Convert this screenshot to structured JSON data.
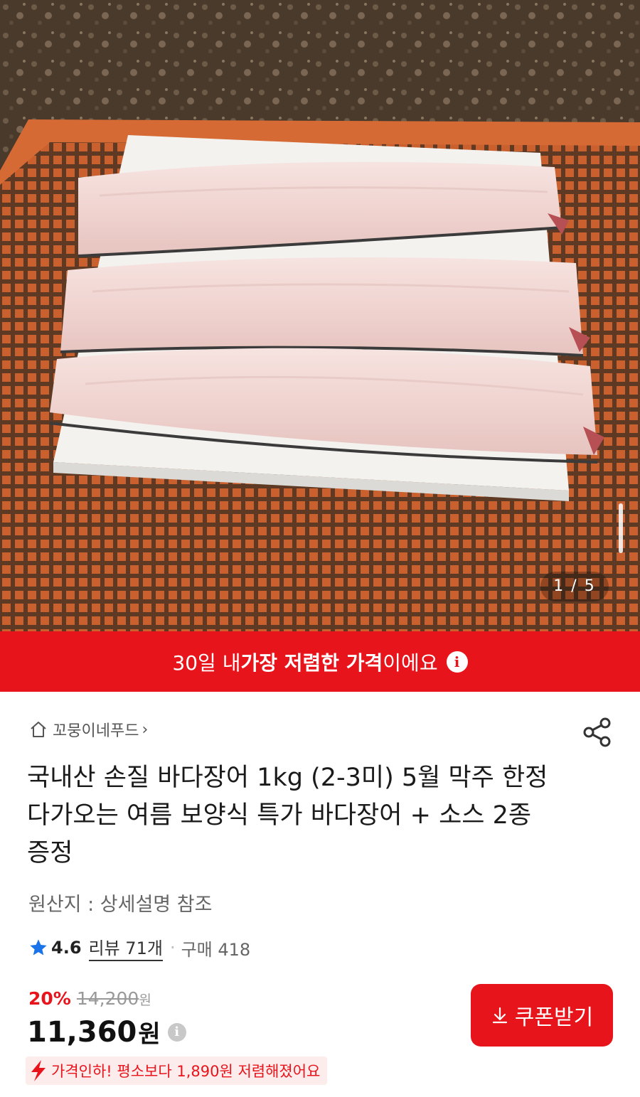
{
  "hero": {
    "image_alt": "손질 바다장어 on orange crate",
    "page_indicator": "1 / 5"
  },
  "banner": {
    "prefix": "30일 내 ",
    "bold": "가장 저렴한 가격",
    "suffix": "이에요"
  },
  "store": {
    "name": "꼬뭉이네푸드"
  },
  "product": {
    "title": "국내산 손질 바다장어 1kg (2-3미) 5월 막주 한정 다가오는 여름 보양식 특가 바다장어 + 소스 2종 증정",
    "origin": "원산지 : 상세설명 참조",
    "rating": "4.6",
    "review_label": "리뷰 71개",
    "purchase_label": "구매 418"
  },
  "price": {
    "discount_pct": "20%",
    "original": "14,200",
    "original_unit": "원",
    "current": "11,360",
    "current_unit": "원",
    "drop_note": "가격인하! 평소보다 1,890원 저렴해졌어요"
  },
  "coupon": {
    "label": "쿠폰받기"
  },
  "colors": {
    "accent": "#e8141c",
    "star": "#1a73e8"
  }
}
